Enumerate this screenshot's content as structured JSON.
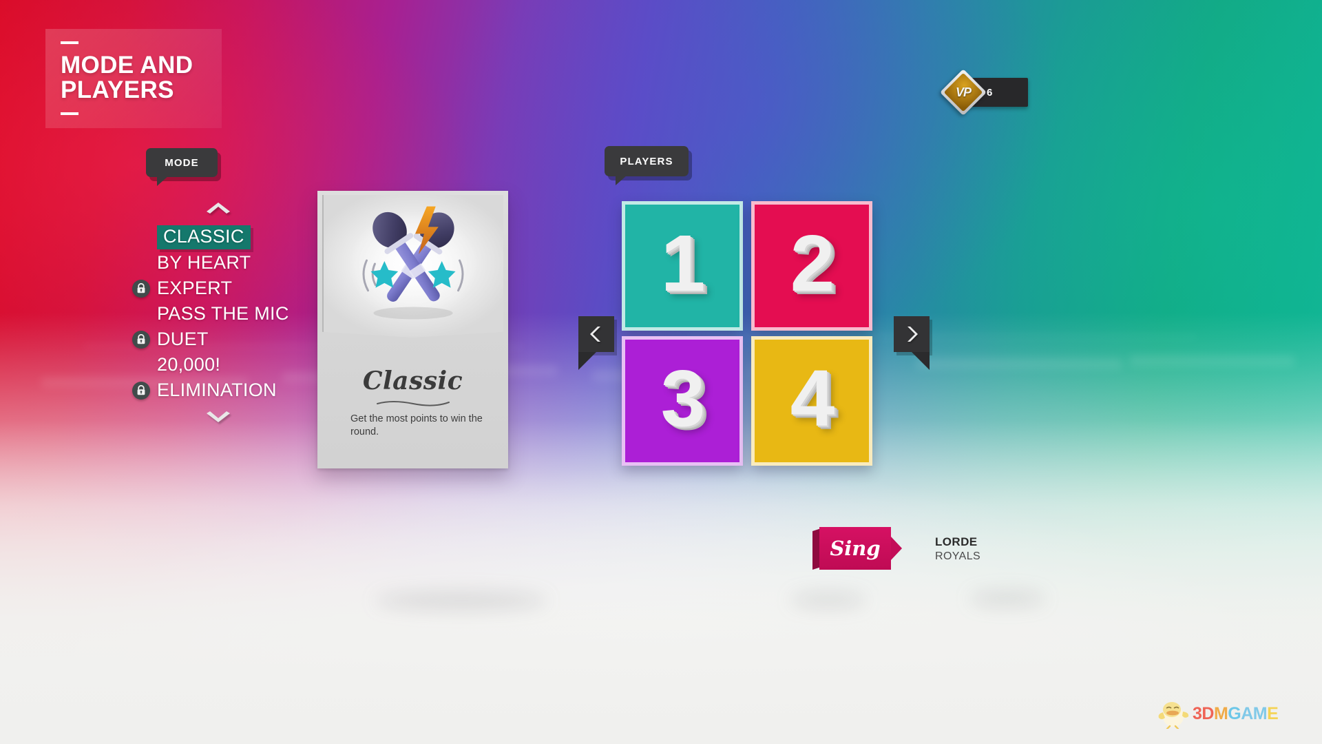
{
  "screen": {
    "title_line1": "MODE AND",
    "title_line2": "PLAYERS"
  },
  "currency": {
    "icon": "vp-diamond-icon",
    "label": "VP",
    "amount": "6"
  },
  "mode_panel": {
    "bubble_label": "MODE",
    "scroll_up_icon": "chevron-up-icon",
    "scroll_down_icon": "chevron-down-icon",
    "items": [
      {
        "label": "CLASSIC",
        "locked": false,
        "selected": true
      },
      {
        "label": "BY HEART",
        "locked": false,
        "selected": false
      },
      {
        "label": "EXPERT",
        "locked": true,
        "selected": false
      },
      {
        "label": "PASS THE MIC",
        "locked": false,
        "selected": false
      },
      {
        "label": "DUET",
        "locked": true,
        "selected": false
      },
      {
        "label": "20,000!",
        "locked": false,
        "selected": false
      },
      {
        "label": "ELIMINATION",
        "locked": true,
        "selected": false
      }
    ]
  },
  "mode_card": {
    "name": "Classic",
    "description": "Get the most points to win the round.",
    "art_icon": "crossed-microphones-icon"
  },
  "players_panel": {
    "bubble_label": "PLAYERS",
    "prev_icon": "chevron-left-icon",
    "next_icon": "chevron-right-icon",
    "tiles": [
      {
        "number": "1",
        "color": "#21b4a6"
      },
      {
        "number": "2",
        "color": "#e40d51"
      },
      {
        "number": "3",
        "color": "#ac1fd6"
      },
      {
        "number": "4",
        "color": "#e8b814"
      }
    ]
  },
  "footer": {
    "sing_label": "Sing",
    "artist": "LORDE",
    "song": "ROYALS"
  },
  "watermark": {
    "text": "3DMGAME",
    "mascot_icon": "chick-mascot-icon"
  }
}
